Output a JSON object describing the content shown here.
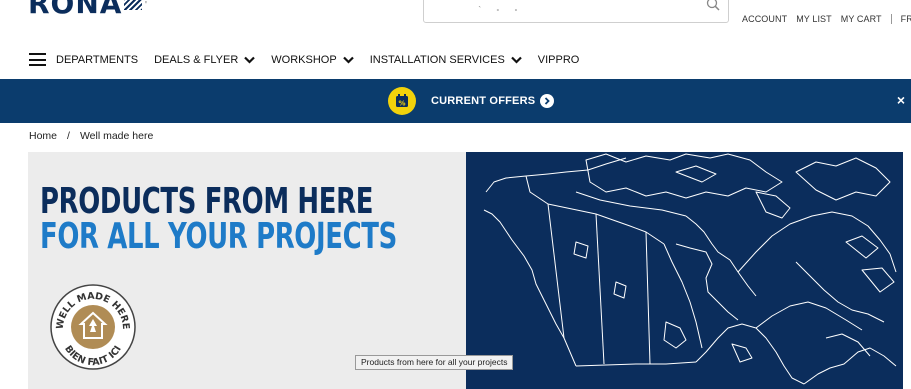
{
  "header": {
    "logo_text": "RONA",
    "search_marks": "˴ ˳ ˳",
    "account_links": [
      "ACCOUNT",
      "MY LIST",
      "MY CART"
    ],
    "language": "FR"
  },
  "nav": {
    "items": [
      {
        "label": "DEPARTMENTS",
        "has_dropdown": false
      },
      {
        "label": "DEALS & FLYER",
        "has_dropdown": true
      },
      {
        "label": "WORKSHOP",
        "has_dropdown": true
      },
      {
        "label": "INSTALLATION SERVICES",
        "has_dropdown": true
      },
      {
        "label": "VIPPRO",
        "has_dropdown": false
      }
    ]
  },
  "offers_bar": {
    "label": "CURRENT OFFERS",
    "close_symbol": "×",
    "background": "#0b3c6d",
    "badge_color": "#f2d20b"
  },
  "breadcrumb": {
    "items": [
      "Home",
      "Well made here"
    ],
    "separator": "/"
  },
  "hero": {
    "headline_line1": "PRODUCTS FROM HERE",
    "headline_line2": "FOR ALL YOUR PROJECTS",
    "seal_top": "WELL MADE HERE",
    "seal_bottom": "BIEN FAIT ICI",
    "map_background": "#0b2d5c"
  },
  "tooltip": {
    "text": "Products from here for all your projects"
  }
}
